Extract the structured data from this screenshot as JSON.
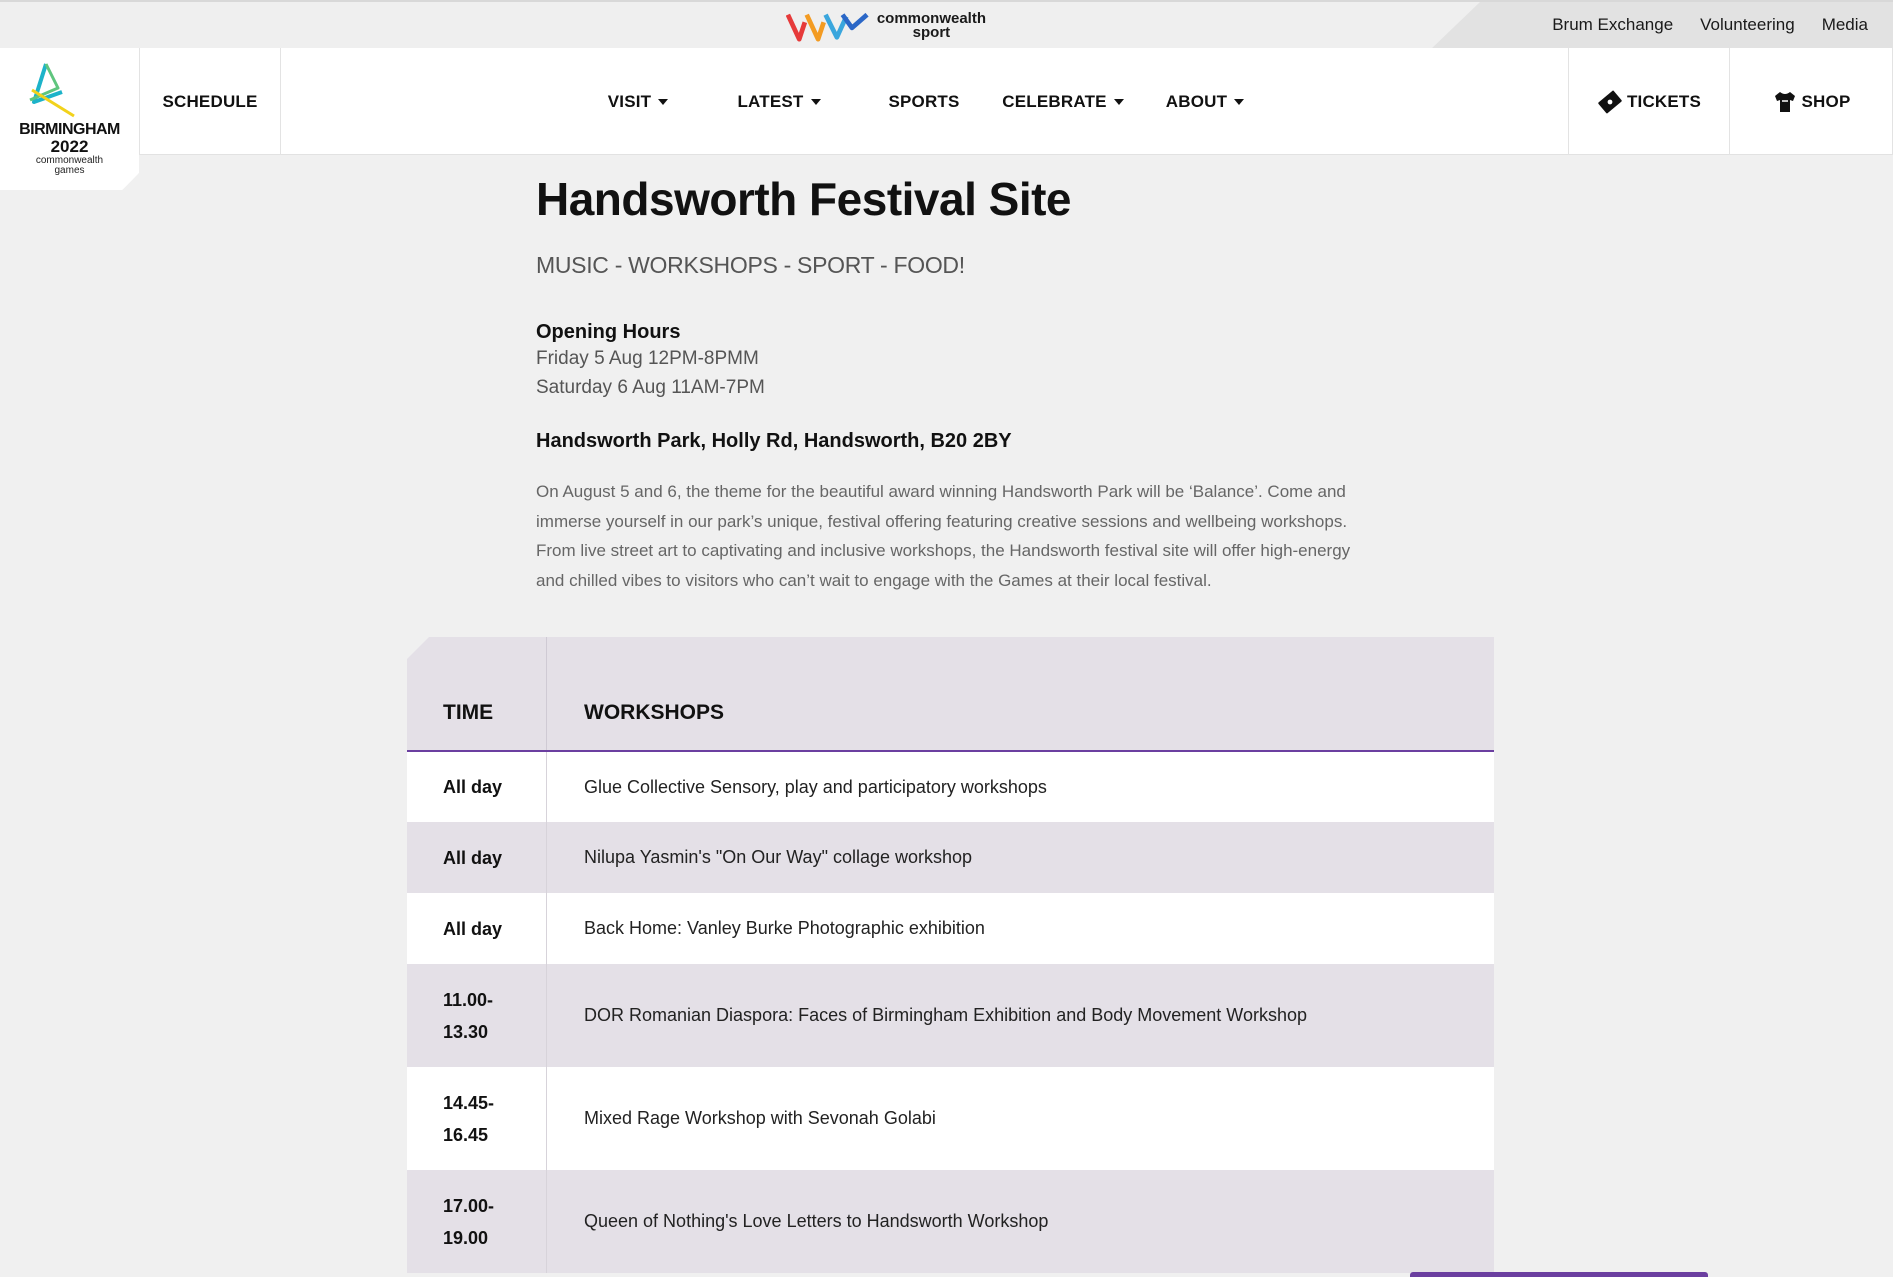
{
  "topbar": {
    "brand_text_line1": "commonwealth",
    "brand_text_line2": "sport",
    "links": [
      "Brum Exchange",
      "Volunteering",
      "Media"
    ]
  },
  "logo": {
    "line1": "BIRMINGHAM",
    "line2": "2022",
    "line3": "commonwealth",
    "line4": "games"
  },
  "nav": {
    "schedule": "SCHEDULE",
    "visit": "VISIT",
    "latest": "LATEST",
    "sports": "SPORTS",
    "celebrate": "CELEBRATE",
    "about": "ABOUT",
    "tickets": "TICKETS",
    "shop": "SHOP"
  },
  "page": {
    "title": "Handsworth Festival Site",
    "tagline": "MUSIC - WORKSHOPS - SPORT - FOOD!",
    "hours_title": "Opening Hours",
    "hours": [
      "Friday 5 Aug 12PM-8PMM",
      "Saturday 6 Aug 11AM-7PM"
    ],
    "address": "Handsworth Park, Holly Rd, Handsworth, B20 2BY",
    "description": "On August 5 and 6, the theme for the beautiful award winning Handsworth Park will be ‘Balance’. Come and immerse yourself in our park’s unique, festival offering featuring creative sessions and wellbeing workshops. From live street art to captivating and inclusive workshops,  the Handsworth festival site will offer high-energy and chilled vibes to visitors who can’t wait to engage with the Games at their local festival."
  },
  "table": {
    "headers": {
      "time": "TIME",
      "workshops": "WORKSHOPS"
    },
    "rows": [
      {
        "time": "All day",
        "workshop": "Glue Collective Sensory, play and participatory workshops"
      },
      {
        "time": "All day",
        "workshop": "Nilupa Yasmin's \"On Our Way\" collage workshop"
      },
      {
        "time": "All day",
        "workshop": "Back Home: Vanley Burke Photographic exhibition"
      },
      {
        "time": "11.00-13.30",
        "time_l1": "11.00-",
        "time_l2": "13.30",
        "workshop": "DOR Romanian Diaspora: Faces of Birmingham Exhibition and Body Movement Workshop"
      },
      {
        "time": "14.45-16.45",
        "time_l1": "14.45-",
        "time_l2": "16.45",
        "workshop": "Mixed Rage Workshop with Sevonah Golabi"
      },
      {
        "time": "17.00-19.00",
        "time_l1": "17.00-",
        "time_l2": "19.00",
        "workshop": "Queen of Nothing's Love Letters to Handsworth Workshop"
      }
    ]
  },
  "colors": {
    "accent_purple": "#6b3fa0",
    "table_tint": "#e4e0e7",
    "page_bg": "#f0f0f0"
  },
  "icons": [
    "commonwealth-sport-logo",
    "birmingham-2022-logo",
    "ticket-icon",
    "shirt-icon",
    "chevron-down-icon"
  ]
}
